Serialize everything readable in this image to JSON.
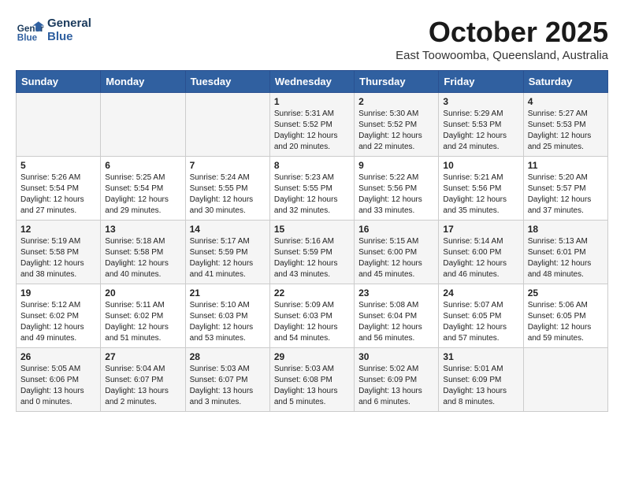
{
  "header": {
    "logo_line1": "General",
    "logo_line2": "Blue",
    "month": "October 2025",
    "location": "East Toowoomba, Queensland, Australia"
  },
  "days_of_week": [
    "Sunday",
    "Monday",
    "Tuesday",
    "Wednesday",
    "Thursday",
    "Friday",
    "Saturday"
  ],
  "weeks": [
    [
      {
        "day": "",
        "content": ""
      },
      {
        "day": "",
        "content": ""
      },
      {
        "day": "",
        "content": ""
      },
      {
        "day": "1",
        "content": "Sunrise: 5:31 AM\nSunset: 5:52 PM\nDaylight: 12 hours\nand 20 minutes."
      },
      {
        "day": "2",
        "content": "Sunrise: 5:30 AM\nSunset: 5:52 PM\nDaylight: 12 hours\nand 22 minutes."
      },
      {
        "day": "3",
        "content": "Sunrise: 5:29 AM\nSunset: 5:53 PM\nDaylight: 12 hours\nand 24 minutes."
      },
      {
        "day": "4",
        "content": "Sunrise: 5:27 AM\nSunset: 5:53 PM\nDaylight: 12 hours\nand 25 minutes."
      }
    ],
    [
      {
        "day": "5",
        "content": "Sunrise: 5:26 AM\nSunset: 5:54 PM\nDaylight: 12 hours\nand 27 minutes."
      },
      {
        "day": "6",
        "content": "Sunrise: 5:25 AM\nSunset: 5:54 PM\nDaylight: 12 hours\nand 29 minutes."
      },
      {
        "day": "7",
        "content": "Sunrise: 5:24 AM\nSunset: 5:55 PM\nDaylight: 12 hours\nand 30 minutes."
      },
      {
        "day": "8",
        "content": "Sunrise: 5:23 AM\nSunset: 5:55 PM\nDaylight: 12 hours\nand 32 minutes."
      },
      {
        "day": "9",
        "content": "Sunrise: 5:22 AM\nSunset: 5:56 PM\nDaylight: 12 hours\nand 33 minutes."
      },
      {
        "day": "10",
        "content": "Sunrise: 5:21 AM\nSunset: 5:56 PM\nDaylight: 12 hours\nand 35 minutes."
      },
      {
        "day": "11",
        "content": "Sunrise: 5:20 AM\nSunset: 5:57 PM\nDaylight: 12 hours\nand 37 minutes."
      }
    ],
    [
      {
        "day": "12",
        "content": "Sunrise: 5:19 AM\nSunset: 5:58 PM\nDaylight: 12 hours\nand 38 minutes."
      },
      {
        "day": "13",
        "content": "Sunrise: 5:18 AM\nSunset: 5:58 PM\nDaylight: 12 hours\nand 40 minutes."
      },
      {
        "day": "14",
        "content": "Sunrise: 5:17 AM\nSunset: 5:59 PM\nDaylight: 12 hours\nand 41 minutes."
      },
      {
        "day": "15",
        "content": "Sunrise: 5:16 AM\nSunset: 5:59 PM\nDaylight: 12 hours\nand 43 minutes."
      },
      {
        "day": "16",
        "content": "Sunrise: 5:15 AM\nSunset: 6:00 PM\nDaylight: 12 hours\nand 45 minutes."
      },
      {
        "day": "17",
        "content": "Sunrise: 5:14 AM\nSunset: 6:00 PM\nDaylight: 12 hours\nand 46 minutes."
      },
      {
        "day": "18",
        "content": "Sunrise: 5:13 AM\nSunset: 6:01 PM\nDaylight: 12 hours\nand 48 minutes."
      }
    ],
    [
      {
        "day": "19",
        "content": "Sunrise: 5:12 AM\nSunset: 6:02 PM\nDaylight: 12 hours\nand 49 minutes."
      },
      {
        "day": "20",
        "content": "Sunrise: 5:11 AM\nSunset: 6:02 PM\nDaylight: 12 hours\nand 51 minutes."
      },
      {
        "day": "21",
        "content": "Sunrise: 5:10 AM\nSunset: 6:03 PM\nDaylight: 12 hours\nand 53 minutes."
      },
      {
        "day": "22",
        "content": "Sunrise: 5:09 AM\nSunset: 6:03 PM\nDaylight: 12 hours\nand 54 minutes."
      },
      {
        "day": "23",
        "content": "Sunrise: 5:08 AM\nSunset: 6:04 PM\nDaylight: 12 hours\nand 56 minutes."
      },
      {
        "day": "24",
        "content": "Sunrise: 5:07 AM\nSunset: 6:05 PM\nDaylight: 12 hours\nand 57 minutes."
      },
      {
        "day": "25",
        "content": "Sunrise: 5:06 AM\nSunset: 6:05 PM\nDaylight: 12 hours\nand 59 minutes."
      }
    ],
    [
      {
        "day": "26",
        "content": "Sunrise: 5:05 AM\nSunset: 6:06 PM\nDaylight: 13 hours\nand 0 minutes."
      },
      {
        "day": "27",
        "content": "Sunrise: 5:04 AM\nSunset: 6:07 PM\nDaylight: 13 hours\nand 2 minutes."
      },
      {
        "day": "28",
        "content": "Sunrise: 5:03 AM\nSunset: 6:07 PM\nDaylight: 13 hours\nand 3 minutes."
      },
      {
        "day": "29",
        "content": "Sunrise: 5:03 AM\nSunset: 6:08 PM\nDaylight: 13 hours\nand 5 minutes."
      },
      {
        "day": "30",
        "content": "Sunrise: 5:02 AM\nSunset: 6:09 PM\nDaylight: 13 hours\nand 6 minutes."
      },
      {
        "day": "31",
        "content": "Sunrise: 5:01 AM\nSunset: 6:09 PM\nDaylight: 13 hours\nand 8 minutes."
      },
      {
        "day": "",
        "content": ""
      }
    ]
  ]
}
